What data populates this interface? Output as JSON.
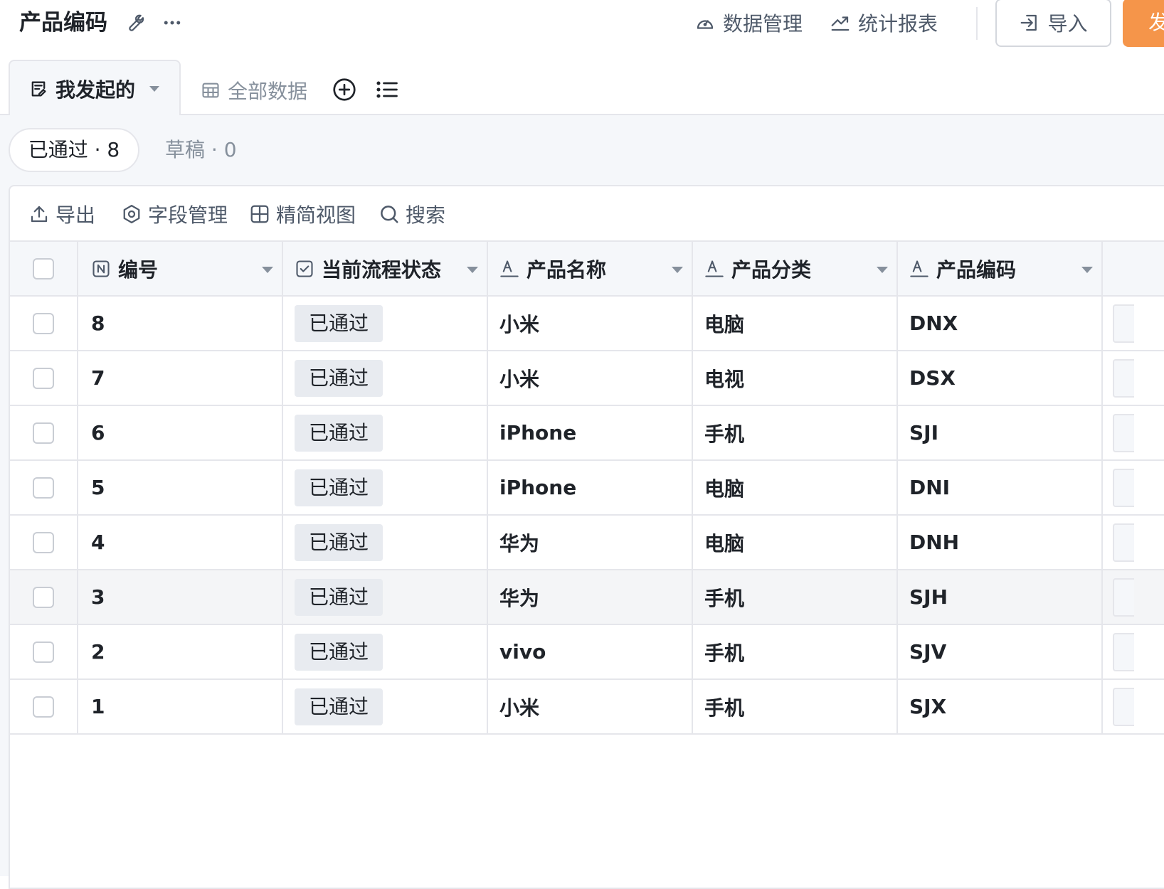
{
  "header": {
    "title": "产品编码",
    "data_manage_label": "数据管理",
    "stats_report_label": "统计报表",
    "import_label": "导入",
    "publish_label": "发"
  },
  "tabs": {
    "active_label": "我发起的",
    "all_data_label": "全部数据"
  },
  "status_filters": [
    {
      "label": "已通过 · 8"
    },
    {
      "label": "草稿 · 0"
    }
  ],
  "toolbar": {
    "export_label": "导出",
    "field_manage_label": "字段管理",
    "compact_view_label": "精简视图",
    "search_label": "搜索"
  },
  "table": {
    "columns": [
      {
        "label": "编号",
        "icon": "number-field-icon"
      },
      {
        "label": "当前流程状态",
        "icon": "checkbox-field-icon"
      },
      {
        "label": "产品名称",
        "icon": "text-field-icon"
      },
      {
        "label": "产品分类",
        "icon": "text-field-icon"
      },
      {
        "label": "产品编码",
        "icon": "text-field-icon"
      }
    ],
    "rows": [
      {
        "id": "8",
        "status": "已通过",
        "name": "小米",
        "category": "电脑",
        "code": "DNX"
      },
      {
        "id": "7",
        "status": "已通过",
        "name": "小米",
        "category": "电视",
        "code": "DSX"
      },
      {
        "id": "6",
        "status": "已通过",
        "name": "iPhone",
        "category": "手机",
        "code": "SJI"
      },
      {
        "id": "5",
        "status": "已通过",
        "name": "iPhone",
        "category": "电脑",
        "code": "DNI"
      },
      {
        "id": "4",
        "status": "已通过",
        "name": "华为",
        "category": "电脑",
        "code": "DNH"
      },
      {
        "id": "3",
        "status": "已通过",
        "name": "华为",
        "category": "手机",
        "code": "SJH"
      },
      {
        "id": "2",
        "status": "已通过",
        "name": "vivo",
        "category": "手机",
        "code": "SJV"
      },
      {
        "id": "1",
        "status": "已通过",
        "name": "小米",
        "category": "手机",
        "code": "SJX"
      }
    ],
    "hovered_row_index": 5
  },
  "colors": {
    "accent": "#f5954a",
    "border": "#e5e6eb",
    "muted_text": "#86909c",
    "tag_bg": "#e8ebf0"
  }
}
